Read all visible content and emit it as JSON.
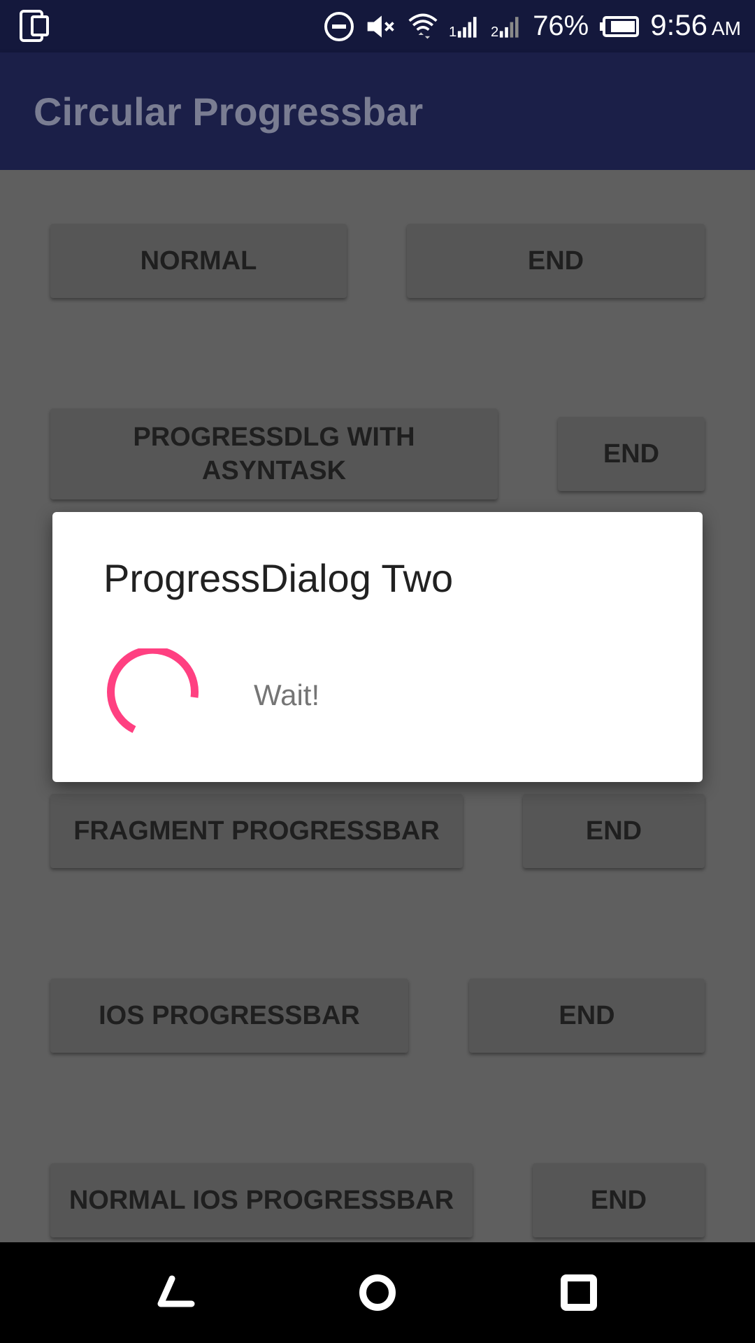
{
  "status_bar": {
    "battery_percent": "76%",
    "time": "9:56",
    "ampm": "AM",
    "icons": [
      "phone-device-icon",
      "do-not-disturb-icon",
      "volume-muted-icon",
      "wifi-icon",
      "signal-sim1-icon",
      "signal-sim2-icon",
      "battery-icon"
    ]
  },
  "app_bar": {
    "title": "Circular Progressbar"
  },
  "buttons": {
    "normal": "NORMAL",
    "normal_end": "END",
    "progressdlg_line1": "PROGRESSDLG WITH",
    "progressdlg_line2": "ASYNTASK",
    "progressdlg_end": "END",
    "fragment": "FRAGMENT PROGRESSBAR",
    "fragment_end": "END",
    "ios": "IOS PROGRESSBAR",
    "ios_end": "END",
    "normal_ios": "NORMAL IOS PROGRESSBAR",
    "normal_ios_end": "END"
  },
  "dialog": {
    "title": "ProgressDialog Two",
    "message": "Wait!",
    "spinner_color": "#ff4081"
  },
  "colors": {
    "status_bar": "#14183c",
    "app_bar": "#1b1f48",
    "accent": "#ff4081"
  },
  "nav_bar": {
    "icons": [
      "back-icon",
      "home-icon",
      "recents-icon"
    ]
  }
}
